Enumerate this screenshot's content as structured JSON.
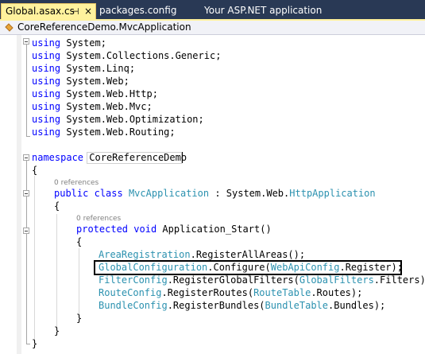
{
  "tabs": [
    {
      "label": "Global.asax.cs",
      "active": true
    },
    {
      "label": "packages.config",
      "active": false
    },
    {
      "label": "Your ASP.NET application",
      "active": false
    }
  ],
  "tab_icons": {
    "pin": "pin-icon",
    "close": "close-icon"
  },
  "navbar": {
    "icon": "class-icon",
    "text": "CoreReferenceDemo.MvcApplication"
  },
  "code": {
    "using_kw": "using",
    "usings": [
      "System;",
      "System.Collections.Generic;",
      "System.Linq;",
      "System.Web;",
      "System.Web.Http;",
      "System.Web.Mvc;",
      "System.Web.Optimization;",
      "System.Web.Routing;"
    ],
    "namespace_kw": "namespace",
    "namespace_name": "CoreReferenceDemo",
    "open_brace": "{",
    "close_brace": "}",
    "refs_class": "0 references",
    "public_kw": "public",
    "class_kw": "class",
    "class_name": "MvcApplication",
    "class_sep": " : System.Web.",
    "base_class": "HttpApplication",
    "refs_method": "0 references",
    "protected_kw": "protected",
    "void_kw": "void",
    "method_name": "Application_Start()",
    "line1_type": "AreaRegistration",
    "line1_rest": ".RegisterAllAreas();",
    "line2_type": "GlobalConfiguration",
    "line2_mid": ".Configure(",
    "line2_arg_type": "WebApiConfig",
    "line2_end": ".Register);",
    "line3_type": "FilterConfig",
    "line3_mid": ".RegisterGlobalFilters(",
    "line3_arg_type": "GlobalFilters",
    "line3_end": ".Filters);",
    "line4_type": "RouteConfig",
    "line4_mid": ".RegisterRoutes(",
    "line4_arg_type": "RouteTable",
    "line4_end": ".Routes);",
    "line5_type": "BundleConfig",
    "line5_mid": ".RegisterBundles(",
    "line5_arg_type": "BundleTable",
    "line5_end": ".Bundles);"
  },
  "colors": {
    "keyword": "#0000ff",
    "type": "#2b91af",
    "tab_active": "#fff29d",
    "tabstrip": "#293955"
  }
}
